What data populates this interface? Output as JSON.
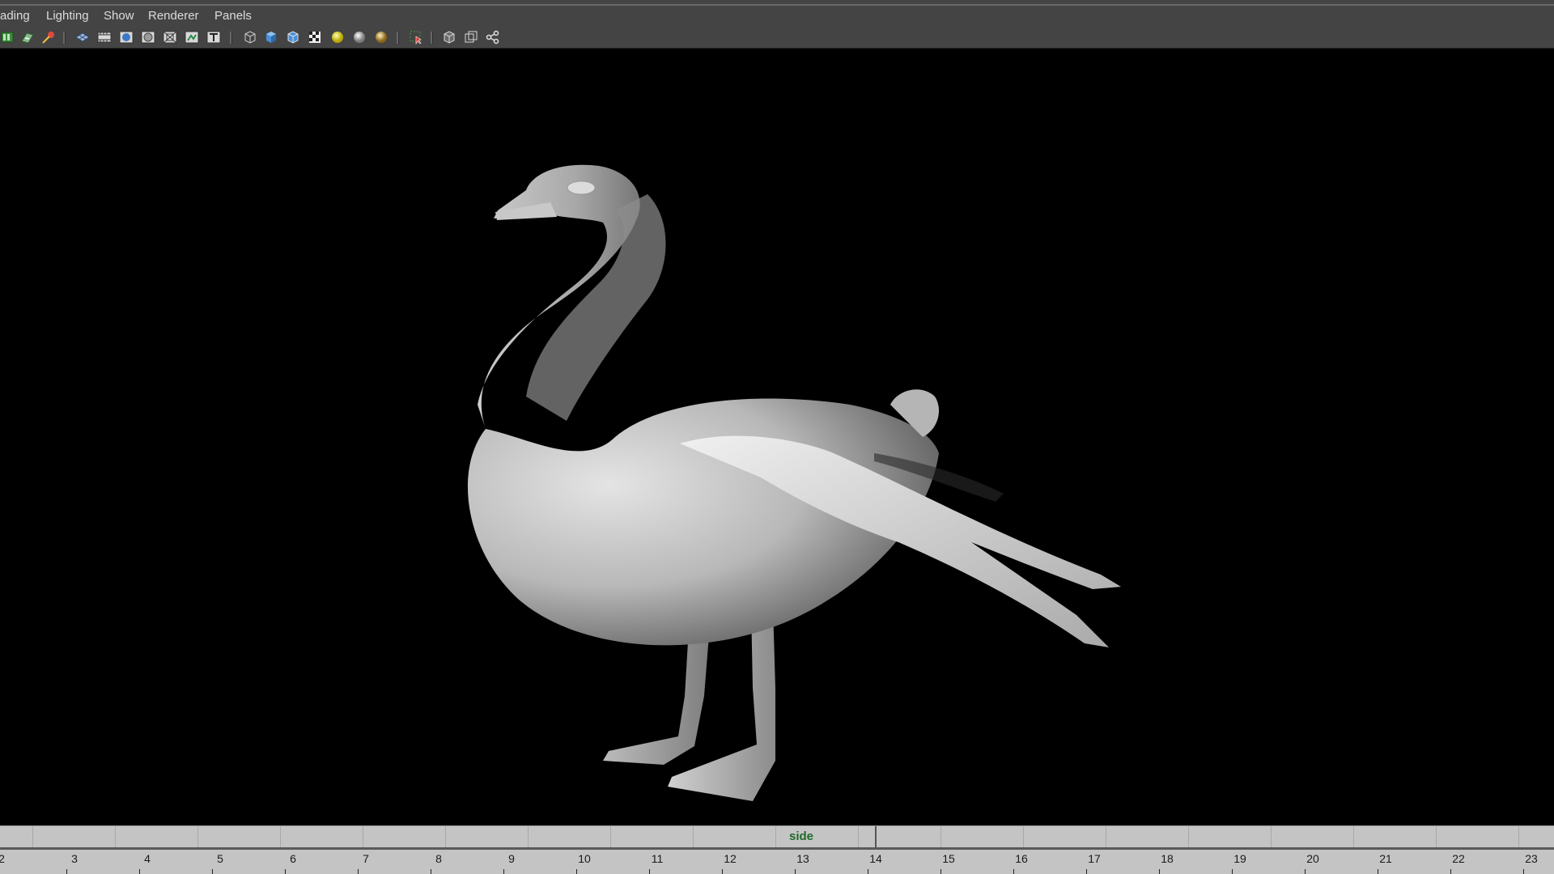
{
  "menu": {
    "items": [
      "ading",
      "Lighting",
      "Show",
      "Renderer",
      "Panels"
    ]
  },
  "toolbar": {
    "icons": [
      "camera-attributes-icon",
      "image-plane-icon",
      "bookmark-icon",
      "grid-icon",
      "film-gate-icon",
      "resolution-gate-icon",
      "gate-mask-icon",
      "field-chart-icon",
      "safe-action-icon",
      "safe-title-icon",
      "wireframe-icon",
      "smooth-shade-icon",
      "wireframe-on-shaded-icon",
      "textured-icon",
      "use-all-lights-icon",
      "shadows-icon",
      "ambient-occlusion-icon",
      "isolate-select-icon",
      "xray-icon",
      "xray-joints-icon",
      "xray-components-icon"
    ]
  },
  "viewport": {
    "subject": "swan-model",
    "background": "#000000",
    "model_color": "#bdbdbd"
  },
  "camera": {
    "name": "side",
    "label_color": "#1f6a2a"
  },
  "timeline": {
    "frames": [
      "2",
      "3",
      "4",
      "5",
      "6",
      "7",
      "8",
      "9",
      "10",
      "11",
      "12",
      "13",
      "14",
      "15",
      "16",
      "17",
      "18",
      "19",
      "20",
      "21",
      "22",
      "23"
    ]
  }
}
